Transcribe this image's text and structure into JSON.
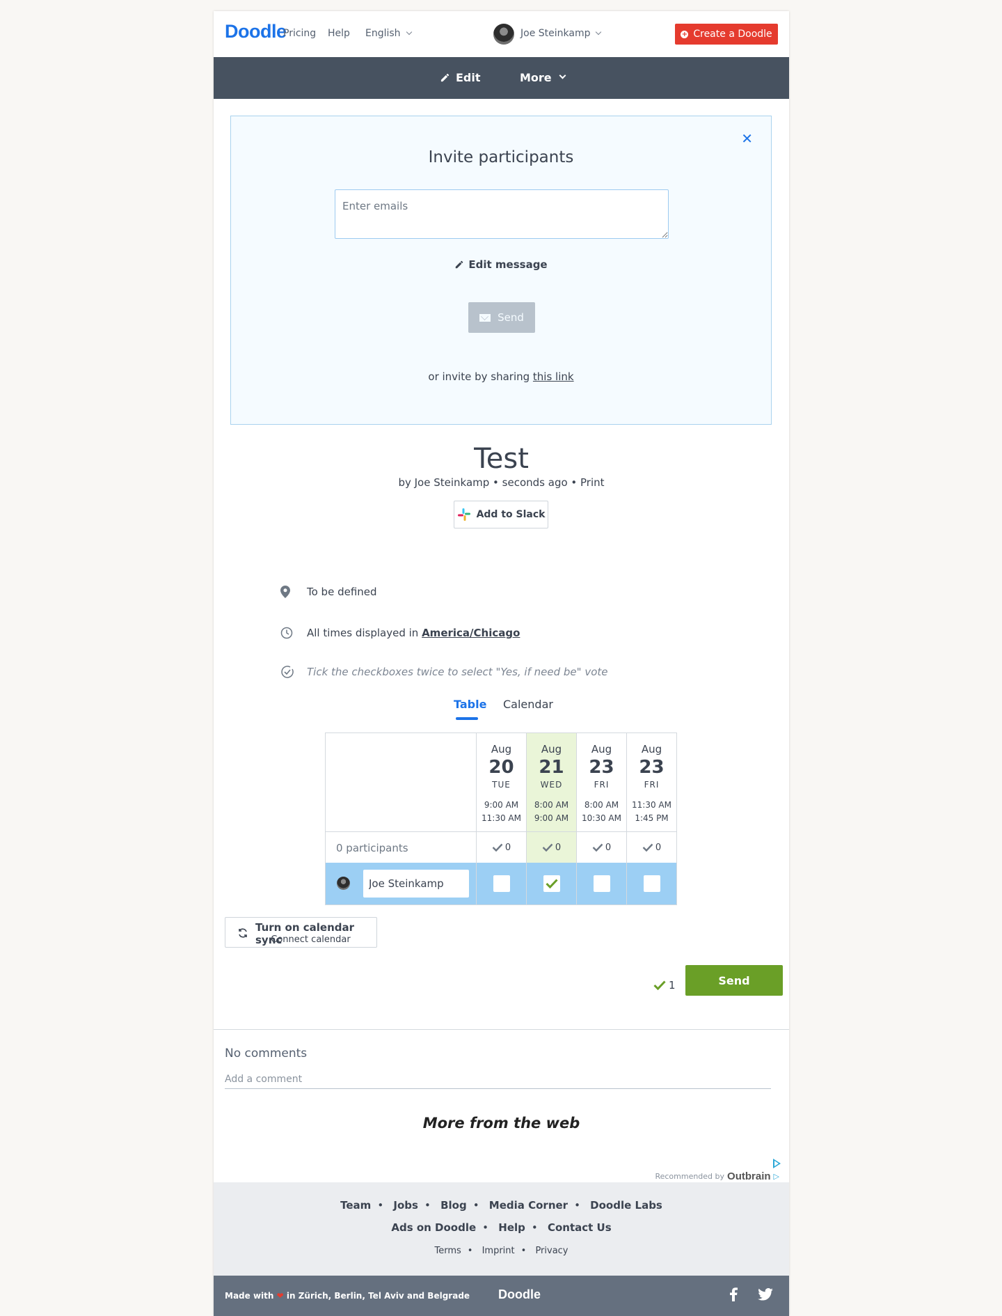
{
  "header": {
    "logo": "Doodle",
    "nav": [
      "Pricing",
      "Help",
      "English"
    ],
    "user_name": "Joe Steinkamp",
    "create_label": "Create a Doodle"
  },
  "subnav": {
    "edit": "Edit",
    "more": "More"
  },
  "invite": {
    "title": "Invite participants",
    "email_placeholder": "Enter emails",
    "edit_message": "Edit message",
    "send": "Send",
    "share_prefix": "or invite by sharing ",
    "share_link": "this link"
  },
  "poll": {
    "title": "Test",
    "meta": "by Joe Steinkamp • seconds ago • Print",
    "slack": "Add to Slack",
    "location": "To be defined",
    "timezone_prefix": "All times displayed in ",
    "timezone": "America/Chicago",
    "hint": "Tick the checkboxes twice to select \"Yes, if need be\" vote"
  },
  "tabs": [
    "Table",
    "Calendar"
  ],
  "table": {
    "participants_label": "0 participants",
    "participant_name": "Joe Steinkamp",
    "options": [
      {
        "month": "Aug",
        "day": "20",
        "dow": "TUE",
        "start": "9:00 AM",
        "end": "11:30 AM",
        "count": "0",
        "checked": false,
        "highlight": false
      },
      {
        "month": "Aug",
        "day": "21",
        "dow": "WED",
        "start": "8:00 AM",
        "end": "9:00 AM",
        "count": "0",
        "checked": true,
        "highlight": true
      },
      {
        "month": "Aug",
        "day": "23",
        "dow": "FRI",
        "start": "8:00 AM",
        "end": "10:30 AM",
        "count": "0",
        "checked": false,
        "highlight": false
      },
      {
        "month": "Aug",
        "day": "23",
        "dow": "FRI",
        "start": "11:30 AM",
        "end": "1:45 PM",
        "count": "0",
        "checked": false,
        "highlight": false
      }
    ]
  },
  "sync": {
    "title": "Turn on calendar sync",
    "subtitle": "Connect calendar"
  },
  "submit": {
    "yes_count": "1",
    "send": "Send"
  },
  "comments": {
    "none": "No comments",
    "placeholder": "Add a comment"
  },
  "more_from_web": "More from the web",
  "outbrain": {
    "prefix": "Recommended by",
    "brand": "Outbrain"
  },
  "footer": {
    "row1": [
      "Team",
      "Jobs",
      "Blog",
      "Media Corner",
      "Doodle Labs"
    ],
    "row2": [
      "Ads on Doodle",
      "Help",
      "Contact Us"
    ],
    "row3": [
      "Terms",
      "Imprint",
      "Privacy"
    ],
    "made_prefix": "Made with",
    "made_suffix": "in Zürich, Berlin, Tel Aviv and Belgrade",
    "logo": "Doodle"
  },
  "colors": {
    "brand_blue": "#1c73e8",
    "create_red": "#e53b2e",
    "send_green": "#6a9f27",
    "subnav_bg": "#475260",
    "vote_row": "#9ccff4",
    "highlight_col": "#eaf5d8"
  }
}
